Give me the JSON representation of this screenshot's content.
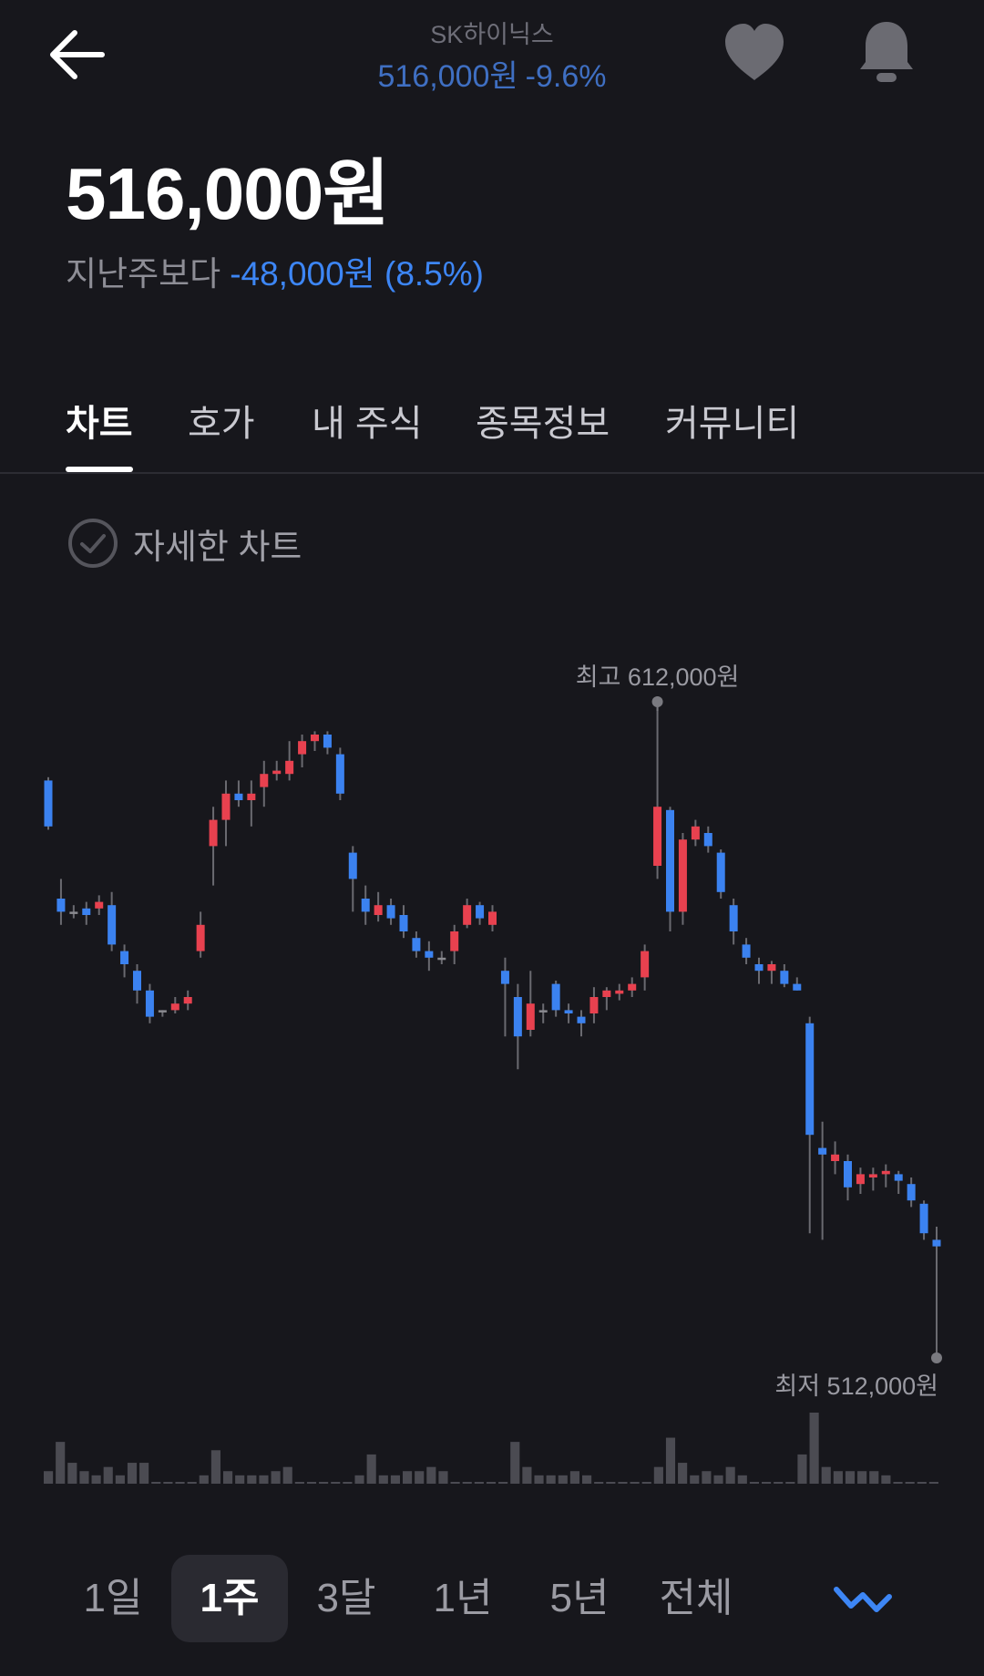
{
  "header": {
    "stock_name": "SK하이닉스",
    "price": "516,000원",
    "change_rate": "-9.6%",
    "back_icon": "arrow-left-icon",
    "heart_icon": "heart-icon",
    "bell_icon": "bell-icon"
  },
  "summary": {
    "price": "516,000원",
    "compare_label": "지난주보다",
    "change": "-48,000원 (8.5%)"
  },
  "tabs": [
    {
      "label": "차트",
      "active": true
    },
    {
      "label": "호가",
      "active": false
    },
    {
      "label": "내 주식",
      "active": false
    },
    {
      "label": "종목정보",
      "active": false
    },
    {
      "label": "커뮤니티",
      "active": false
    }
  ],
  "detail_toggle": {
    "label": "자세한 차트",
    "icon": "check-circle-icon"
  },
  "colors": {
    "up": "#e8414f",
    "down": "#3b82f0",
    "accent": "#3d86f5",
    "volume": "#4b4b52"
  },
  "chart_data": {
    "type": "candlestick",
    "unit": "원",
    "annotations": {
      "high_label": "최고 612,000원",
      "low_label": "최저 512,000원"
    },
    "high": 612000,
    "low": 512000,
    "candles": [
      [
        600000,
        593000,
        600500,
        592500
      ],
      [
        582000,
        580000,
        585000,
        578000
      ],
      [
        580000,
        580000,
        581000,
        579000
      ],
      [
        580500,
        579500,
        581500,
        578000
      ],
      [
        580500,
        581500,
        582500,
        579500
      ],
      [
        581000,
        575000,
        583000,
        574000
      ],
      [
        574000,
        572000,
        575000,
        570000
      ],
      [
        571000,
        568000,
        572000,
        566000
      ],
      [
        568000,
        564000,
        569000,
        563000
      ],
      [
        565000,
        565000,
        565000,
        564000
      ],
      [
        565000,
        566000,
        567000,
        564500
      ],
      [
        566000,
        567000,
        568000,
        565000
      ],
      [
        574000,
        578000,
        580000,
        573000
      ],
      [
        590000,
        594000,
        596000,
        584000
      ],
      [
        594000,
        598000,
        600000,
        590000
      ],
      [
        598000,
        597000,
        600000,
        596000
      ],
      [
        597000,
        598000,
        600000,
        593000
      ],
      [
        599000,
        601000,
        603000,
        596000
      ],
      [
        601000,
        601500,
        603000,
        600000
      ],
      [
        601000,
        603000,
        606000,
        600000
      ],
      [
        604000,
        606000,
        607000,
        602000
      ],
      [
        606000,
        607000,
        607500,
        604500
      ],
      [
        607000,
        605000,
        607500,
        604000
      ],
      [
        604000,
        598000,
        605000,
        597000
      ],
      [
        589000,
        585000,
        590000,
        580000
      ],
      [
        582000,
        580000,
        584000,
        578000
      ],
      [
        579500,
        581000,
        583000,
        578500
      ],
      [
        581000,
        579000,
        582000,
        578000
      ],
      [
        579500,
        577000,
        581000,
        576000
      ],
      [
        576000,
        574000,
        577000,
        573000
      ],
      [
        574000,
        573000,
        575500,
        571000
      ],
      [
        573000,
        573000,
        574000,
        572000
      ],
      [
        574000,
        577000,
        578000,
        572000
      ],
      [
        578000,
        581000,
        582000,
        577500
      ],
      [
        581000,
        579000,
        581500,
        578000
      ],
      [
        578000,
        580000,
        581000,
        577000
      ],
      [
        571000,
        569000,
        573000,
        561000
      ],
      [
        567000,
        561000,
        569000,
        556000
      ],
      [
        562000,
        566000,
        571000,
        561000
      ],
      [
        565000,
        565000,
        566000,
        563000
      ],
      [
        569000,
        565000,
        569500,
        564000
      ],
      [
        565000,
        564500,
        566000,
        563000
      ],
      [
        564000,
        563000,
        565000,
        561000
      ],
      [
        564500,
        567000,
        568500,
        563000
      ],
      [
        567000,
        568000,
        568500,
        565000
      ],
      [
        567500,
        568000,
        569000,
        566500
      ],
      [
        568000,
        569000,
        570000,
        567000
      ],
      [
        570000,
        574000,
        575000,
        568000
      ],
      [
        587000,
        596000,
        612000,
        585000
      ],
      [
        595500,
        580000,
        596000,
        577000
      ],
      [
        580000,
        591000,
        592000,
        578000
      ],
      [
        591000,
        593000,
        594000,
        590000
      ],
      [
        592000,
        590000,
        593000,
        589000
      ],
      [
        589000,
        583000,
        589500,
        582000
      ],
      [
        581000,
        577000,
        582000,
        575000
      ],
      [
        575000,
        573000,
        576000,
        572000
      ],
      [
        572000,
        571000,
        573000,
        569000
      ],
      [
        571000,
        572000,
        572500,
        569000
      ],
      [
        571000,
        569000,
        572000,
        568500
      ],
      [
        569000,
        568000,
        570000,
        568000
      ],
      [
        563000,
        546000,
        564000,
        531000
      ],
      [
        544000,
        543000,
        548000,
        530000
      ],
      [
        542000,
        543000,
        545000,
        540000
      ],
      [
        542000,
        538000,
        543000,
        536000
      ],
      [
        538500,
        540000,
        541000,
        537000
      ],
      [
        539500,
        540000,
        541000,
        537500
      ],
      [
        540000,
        540500,
        541500,
        538000
      ],
      [
        540000,
        539000,
        540500,
        537000
      ],
      [
        538500,
        536000,
        539500,
        535000
      ],
      [
        535500,
        531000,
        536000,
        530000
      ],
      [
        530000,
        529000,
        532000,
        512000
      ]
    ],
    "volume": [
      3,
      10,
      5,
      3,
      2,
      4,
      2,
      5,
      5,
      0,
      0,
      0,
      0,
      2,
      8,
      3,
      2,
      2,
      2,
      3,
      4,
      0,
      0,
      0,
      0,
      0,
      2,
      7,
      2,
      2,
      3,
      3,
      4,
      3,
      0,
      0,
      0,
      0,
      0,
      10,
      4,
      2,
      2,
      2,
      3,
      2,
      0,
      0,
      0,
      0,
      0,
      4,
      11,
      5,
      2,
      3,
      2,
      4,
      2,
      0,
      0,
      0,
      0,
      7,
      17,
      4,
      3,
      3,
      3,
      3,
      2,
      0,
      0,
      0,
      0,
      0,
      0,
      1
    ],
    "visible_volume_bars": 75
  },
  "periods": [
    {
      "label": "1일",
      "active": false
    },
    {
      "label": "1주",
      "active": true
    },
    {
      "label": "3달",
      "active": false
    },
    {
      "label": "1년",
      "active": false
    },
    {
      "label": "5년",
      "active": false
    },
    {
      "label": "전체",
      "active": false
    }
  ],
  "chart_type_icon": "line-chart-icon"
}
